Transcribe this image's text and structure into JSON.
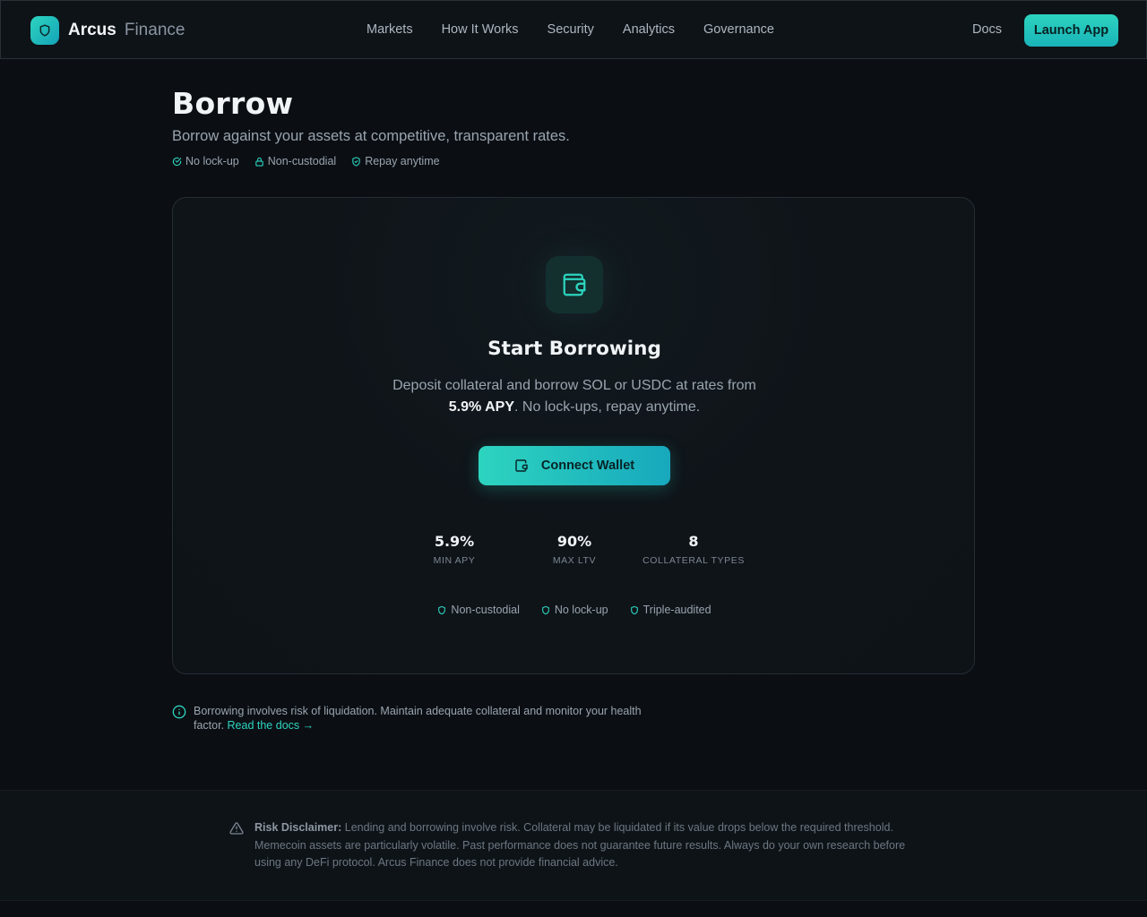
{
  "nav": {
    "brand_name": "Arcus",
    "brand_sub": "Finance",
    "links": [
      "Markets",
      "How It Works",
      "Security",
      "Analytics",
      "Governance"
    ],
    "docs": "Docs",
    "launch": "Launch App"
  },
  "header": {
    "title": "Borrow",
    "subtitle": "Borrow against your assets at competitive, transparent rates.",
    "tags": [
      "No lock-up",
      "Non-custodial",
      "Repay anytime"
    ]
  },
  "card": {
    "title": "Start Borrowing",
    "desc_pre": "Deposit collateral and borrow SOL or USDC at rates from",
    "desc_rate": "5.9% APY",
    "desc_post": ". No lock-ups, repay anytime.",
    "connect": "Connect Wallet",
    "stats": [
      {
        "value": "5.9%",
        "label": "MIN APY"
      },
      {
        "value": "90%",
        "label": "MAX LTV"
      },
      {
        "value": "8",
        "label": "COLLATERAL TYPES"
      }
    ],
    "badges": [
      "Non-custodial",
      "No lock-up",
      "Triple-audited"
    ]
  },
  "note": {
    "text": "Borrowing involves risk of liquidation. Maintain adequate collateral and monitor your health factor.",
    "link": "Read the docs →"
  },
  "footer": {
    "label": "Risk Disclaimer:",
    "text": "Lending and borrowing involve risk. Collateral may be liquidated if its value drops below the required threshold. Memecoin assets are particularly volatile. Past performance does not guarantee future results. Always do your own research before using any DeFi protocol. Arcus Finance does not provide financial advice."
  },
  "colors": {
    "accent": "#2dd4bf",
    "background": "#0b0f14"
  }
}
